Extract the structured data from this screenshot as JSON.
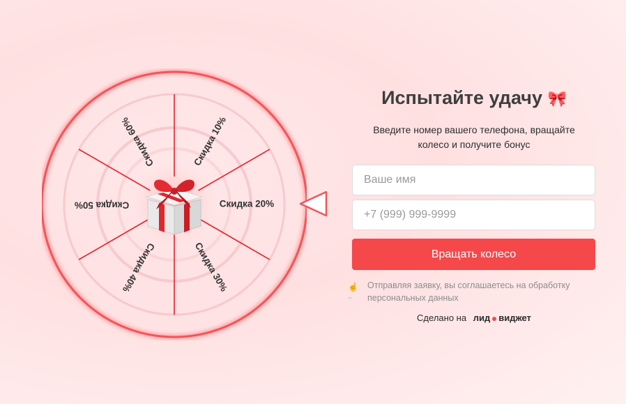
{
  "wheel": {
    "segments": [
      {
        "label": "Скидка 10%"
      },
      {
        "label": "Скидка 20%"
      },
      {
        "label": "Скидка 30%"
      },
      {
        "label": "Скидка 40%"
      },
      {
        "label": "Скидка 50%"
      },
      {
        "label": "Скидка 60%"
      }
    ],
    "center_icon": "gift-box-icon",
    "accent": "#e8202a"
  },
  "panel": {
    "title": "Испытайте удачу",
    "title_icon": "🎀",
    "subtitle_line1": "Введите номер вашего телефона, вращайте",
    "subtitle_line2": "колесо и получите бонус",
    "name_placeholder": "Ваше имя",
    "phone_placeholder": "+7 (999) 999-9999",
    "spin_button": "Вращать колесо",
    "consent_text": "Отправляя заявку, вы соглашаетесь на обработку персональных данных",
    "consent_icon": "1-hand-icon",
    "made_with": "Сделано на",
    "brand_left": "лид",
    "brand_right": "виджет",
    "button_color": "#f5484b"
  }
}
